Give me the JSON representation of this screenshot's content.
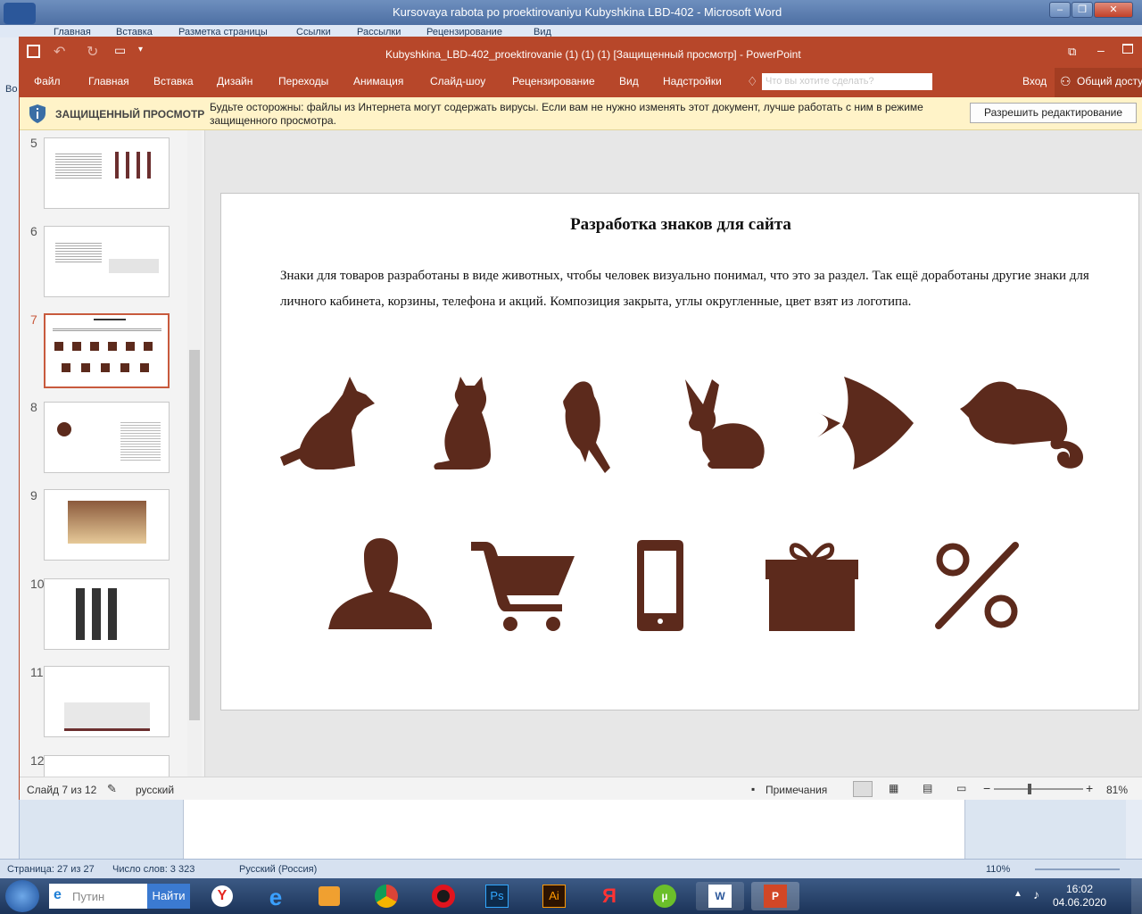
{
  "word": {
    "title": "Kursovaya rabota po proektirovaniyu Kubyshkina LBD-402 - Microsoft Word",
    "tabs": [
      "Главная",
      "Вставка",
      "Разметка страницы",
      "Ссылки",
      "Рассылки",
      "Рецензирование",
      "Вид"
    ],
    "left_tab": "Во",
    "status": {
      "page": "Страница: 27 из 27",
      "words": "Число слов: 3 323",
      "language": "Русский (Россия)",
      "zoom": "110%"
    }
  },
  "ppt": {
    "title": "Kubyshkina_LBD-402_proektirovanie (1) (1) (1) [Защищенный просмотр] - PowerPoint",
    "menu": [
      "Файл",
      "Главная",
      "Вставка",
      "Дизайн",
      "Переходы",
      "Анимация",
      "Слайд-шоу",
      "Рецензирование",
      "Вид",
      "Надстройки"
    ],
    "search_placeholder": "Что вы хотите сделать?",
    "login": "Вход",
    "share": "Общий доступ",
    "warning": {
      "title": "ЗАЩИЩЕННЫЙ ПРОСМОТР",
      "text": "Будьте осторожны: файлы из Интернета могут содержать вирусы. Если вам не нужно изменять этот документ, лучше работать с ним в режиме защищенного просмотра.",
      "button": "Разрешить редактирование"
    },
    "thumbnails": [
      "5",
      "6",
      "7",
      "8",
      "9",
      "10",
      "11",
      "12"
    ],
    "selected_slide": "7",
    "slide": {
      "title": "Разработка знаков для сайта",
      "text": "Знаки для товаров разработаны в виде животных, чтобы человек визуально понимал, что это за раздел. Так ещё доработаны другие знаки для личного кабинета, корзины, телефона и акций. Композиция закрыта, углы округленные, цвет взят из логотипа.",
      "icon_color": "#5c2a1c"
    },
    "status": {
      "slide": "Слайд 7 из 12",
      "language": "русский",
      "notes": "Примечания",
      "zoom": "81%"
    }
  },
  "taskbar": {
    "search_placeholder": "Путин",
    "find": "Найти",
    "time": "16:02",
    "date": "04.06.2020"
  }
}
